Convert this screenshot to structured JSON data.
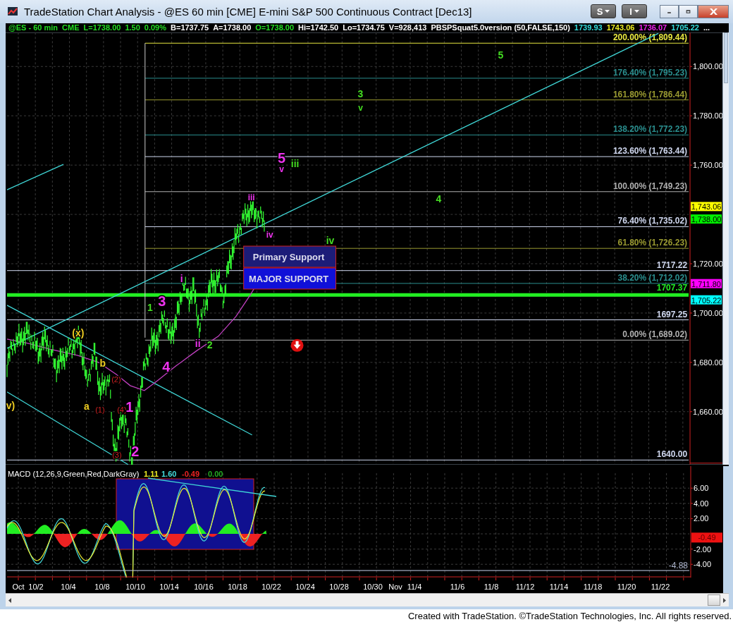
{
  "window": {
    "title": "TradeStation Chart Analysis - @ES 60 min [CME] E-mini S&P 500 Continuous Contract [Dec13]"
  },
  "title_buttons": [
    {
      "label": "S"
    },
    {
      "label": "I"
    }
  ],
  "info_bar": [
    {
      "text": "@ES - 60 min",
      "color": "#22dd22"
    },
    {
      "text": "CME",
      "color": "#22dd22"
    },
    {
      "text": "L=1738.00",
      "color": "#22dd22"
    },
    {
      "text": "1.50",
      "color": "#22dd22"
    },
    {
      "text": "0.09%",
      "color": "#22dd22"
    },
    {
      "text": "B=1737.75",
      "color": "#ffffff"
    },
    {
      "text": "A=1738.00",
      "color": "#ffffff"
    },
    {
      "text": "O=1738.00",
      "color": "#22dd22"
    },
    {
      "text": "Hi=1742.50",
      "color": "#ffffff"
    },
    {
      "text": "Lo=1734.75",
      "color": "#ffffff"
    },
    {
      "text": "V=928,413",
      "color": "#ffffff"
    },
    {
      "text": "PBSPSquat5.0version (50,FALSE,150)",
      "color": "#ffffff"
    },
    {
      "text": "1739.93",
      "color": "#33dddd"
    },
    {
      "text": "1743.06",
      "color": "#eeee22"
    },
    {
      "text": "1736.07",
      "color": "#ee22ee"
    },
    {
      "text": "1705.22",
      "color": "#33dddd"
    },
    {
      "text": "...",
      "color": "#ffffff"
    }
  ],
  "chart": {
    "price_axis": [
      "1,800.00",
      "1,780.00",
      "1,760.00",
      "1,720.00",
      "1,700.00",
      "1,680.00",
      "1,660.00"
    ],
    "price_tags": [
      {
        "text": "1,743.06",
        "color": "#ffff00"
      },
      {
        "text": "1,738.00",
        "color": "#00ee00"
      },
      {
        "text": "1,711.80",
        "color": "#ff00ff"
      },
      {
        "text": "1,705.22",
        "color": "#00ffff"
      }
    ],
    "levels": [
      {
        "label": "200.00% (1,809.44)",
        "color": "#e8e840",
        "kind": "fib"
      },
      {
        "label": "176.40% (1,795.23)",
        "color": "#2a8f8f",
        "kind": "fib"
      },
      {
        "label": "161.80% (1,786.44)",
        "color": "#9a9a30",
        "kind": "fib"
      },
      {
        "label": "138.20% (1,772.23)",
        "color": "#2a8f8f",
        "kind": "fib"
      },
      {
        "label": "123.60% (1,763.44)",
        "color": "#d0d8f0",
        "kind": "fib"
      },
      {
        "label": "100.00% (1,749.23)",
        "color": "#b0b0b0",
        "kind": "fib"
      },
      {
        "label": "76.40% (1,735.02)",
        "color": "#d0d8f0",
        "kind": "fib"
      },
      {
        "label": "61.80% (1,726.23)",
        "color": "#9a9a30",
        "kind": "fib"
      },
      {
        "label": "1717.22",
        "color": "#d0d8f0",
        "kind": "line"
      },
      {
        "label": "38.20% (1,712.02)",
        "color": "#2a8f8f",
        "kind": "fib"
      },
      {
        "label": "1707.37",
        "color": "#22ee22",
        "kind": "major"
      },
      {
        "label": "1697.25",
        "color": "#d0d8f0",
        "kind": "line"
      },
      {
        "label": "0.00% (1,689.02)",
        "color": "#b0b0b0",
        "kind": "fib"
      },
      {
        "label": "1640.00",
        "color": "#d0d8f0",
        "kind": "line"
      }
    ],
    "support_zones": [
      {
        "label": "Primary Support",
        "kind": "primary"
      },
      {
        "label": "MAJOR SUPPORT",
        "kind": "major"
      }
    ],
    "wave_labels": [
      {
        "text": "5",
        "color": "#44dd22",
        "kind": "minor"
      },
      {
        "text": "3",
        "color": "#44dd22",
        "kind": "minor"
      },
      {
        "text": "v",
        "color": "#44dd22",
        "kind": "sub"
      },
      {
        "text": "5",
        "color": "#ee33ee",
        "kind": "major"
      },
      {
        "text": "v",
        "color": "#ee33ee",
        "kind": "sub"
      },
      {
        "text": "iii",
        "color": "#44dd22",
        "kind": "minor"
      },
      {
        "text": "iii",
        "color": "#ee33ee",
        "kind": "sub"
      },
      {
        "text": "4",
        "color": "#44dd22",
        "kind": "minor"
      },
      {
        "text": "iv",
        "color": "#ee33ee",
        "kind": "sub"
      },
      {
        "text": "iv",
        "color": "#44dd22",
        "kind": "minor"
      },
      {
        "text": "i",
        "color": "#ee33ee",
        "kind": "minor"
      },
      {
        "text": "1",
        "color": "#44dd22",
        "kind": "minor"
      },
      {
        "text": "3",
        "color": "#ee33ee",
        "kind": "major"
      },
      {
        "text": "ii",
        "color": "#ee33ee",
        "kind": "minor"
      },
      {
        "text": "2",
        "color": "#44dd22",
        "kind": "minor"
      },
      {
        "text": "4",
        "color": "#ee33ee",
        "kind": "major"
      },
      {
        "text": "(x)",
        "color": "#eecc22",
        "kind": "minor"
      },
      {
        "text": "b",
        "color": "#eecc22",
        "kind": "minor"
      },
      {
        "text": "(2)",
        "color": "#cc2222",
        "kind": "tiny"
      },
      {
        "text": "v)",
        "color": "#eecc22",
        "kind": "minor"
      },
      {
        "text": "a",
        "color": "#eecc22",
        "kind": "minor"
      },
      {
        "text": "(1)",
        "color": "#cc2222",
        "kind": "tiny"
      },
      {
        "text": "(4)",
        "color": "#cc2222",
        "kind": "tiny"
      },
      {
        "text": "1",
        "color": "#ee33ee",
        "kind": "major"
      },
      {
        "text": "(3)",
        "color": "#cc2222",
        "kind": "tiny"
      },
      {
        "text": "2",
        "color": "#ee33ee",
        "kind": "major"
      }
    ]
  },
  "macd": {
    "title": "MACD (12,26,9,Green,Red,DarkGray)",
    "values": [
      {
        "text": "1.11",
        "color": "#eeee22"
      },
      {
        "text": "1.60",
        "color": "#44dddd"
      },
      {
        "text": "-0.49",
        "color": "#ee2222"
      },
      {
        "text": "0.00",
        "color": "#22aa22"
      }
    ],
    "axis": [
      "6.00",
      "4.00",
      "2.00",
      "-2.00",
      "-4.00"
    ],
    "tag": "-0.49",
    "line_label": "-4.88"
  },
  "date_axis": [
    "Oct",
    "10/2",
    "10/4",
    "10/8",
    "10/10",
    "10/14",
    "10/16",
    "10/18",
    "10/22",
    "10/24",
    "10/28",
    "10/30",
    "Nov",
    "11/4",
    "11/6",
    "11/8",
    "11/12",
    "11/14",
    "11/18",
    "11/20",
    "11/22"
  ],
  "footer": "Created with TradeStation. ©TradeStation Technologies, Inc. All rights reserved."
}
